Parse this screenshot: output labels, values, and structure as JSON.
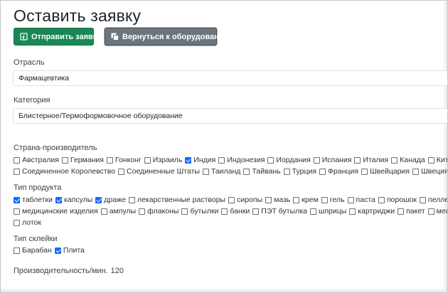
{
  "page_title": "Оставить заявку",
  "buttons": {
    "submit_label": "Отправить заявку",
    "back_label": "Вернуться к оборудованию"
  },
  "colors": {
    "submit": "#198754",
    "back": "#6c757d",
    "checkbox_checked": "#0d6efd"
  },
  "industry": {
    "label": "Отрасль",
    "value": "Фармацевтика"
  },
  "category": {
    "label": "Категория",
    "value": "Блистерное/Термоформовочное оборудование"
  },
  "country": {
    "label": "Страна-производитель",
    "rows": [
      [
        {
          "label": "Австралия",
          "checked": false
        },
        {
          "label": "Германия",
          "checked": false
        },
        {
          "label": "Гонконг",
          "checked": false
        },
        {
          "label": "Израиль",
          "checked": false
        },
        {
          "label": "Индия",
          "checked": true
        },
        {
          "label": "Индонезия",
          "checked": false
        },
        {
          "label": "Иордания",
          "checked": false
        },
        {
          "label": "Испания",
          "checked": false
        },
        {
          "label": "Италия",
          "checked": false
        },
        {
          "label": "Канада",
          "checked": false
        },
        {
          "label": "Китай",
          "checked": false
        }
      ],
      [
        {
          "label": "Соединенное Королевство",
          "checked": false
        },
        {
          "label": "Соединенные Штаты",
          "checked": false
        },
        {
          "label": "Таиланд",
          "checked": false
        },
        {
          "label": "Тайвань",
          "checked": false
        },
        {
          "label": "Турция",
          "checked": false
        },
        {
          "label": "Франция",
          "checked": false
        },
        {
          "label": "Швейцария",
          "checked": false
        },
        {
          "label": "Швеция",
          "checked": false
        }
      ]
    ]
  },
  "product_type": {
    "label": "Тип продукта",
    "rows": [
      [
        {
          "label": "таблетки",
          "checked": true
        },
        {
          "label": "капсулы",
          "checked": true
        },
        {
          "label": "драже",
          "checked": true
        },
        {
          "label": "лекарственные растворы",
          "checked": false
        },
        {
          "label": "сиропы",
          "checked": false
        },
        {
          "label": "мазь",
          "checked": false
        },
        {
          "label": "крем",
          "checked": false
        },
        {
          "label": "гель",
          "checked": false
        },
        {
          "label": "паста",
          "checked": false
        },
        {
          "label": "порошок",
          "checked": false
        },
        {
          "label": "пеллеты",
          "checked": false
        }
      ],
      [
        {
          "label": "медицинские изделия",
          "checked": false
        },
        {
          "label": "ампулы",
          "checked": false
        },
        {
          "label": "флаконы",
          "checked": false
        },
        {
          "label": "бутылки",
          "checked": false
        },
        {
          "label": "банки",
          "checked": false
        },
        {
          "label": "ПЭТ бутылка",
          "checked": false
        },
        {
          "label": "шприцы",
          "checked": false
        },
        {
          "label": "картриджи",
          "checked": false
        },
        {
          "label": "пакет",
          "checked": false
        },
        {
          "label": "мешок",
          "checked": false
        }
      ],
      [
        {
          "label": "лоток",
          "checked": false
        }
      ]
    ]
  },
  "sealing_type": {
    "label": "Тип склейки",
    "rows": [
      [
        {
          "label": "Барабан",
          "checked": false
        },
        {
          "label": "Плита",
          "checked": true
        }
      ]
    ]
  },
  "performance": {
    "label": "Производительность/мин.",
    "value": "120"
  }
}
